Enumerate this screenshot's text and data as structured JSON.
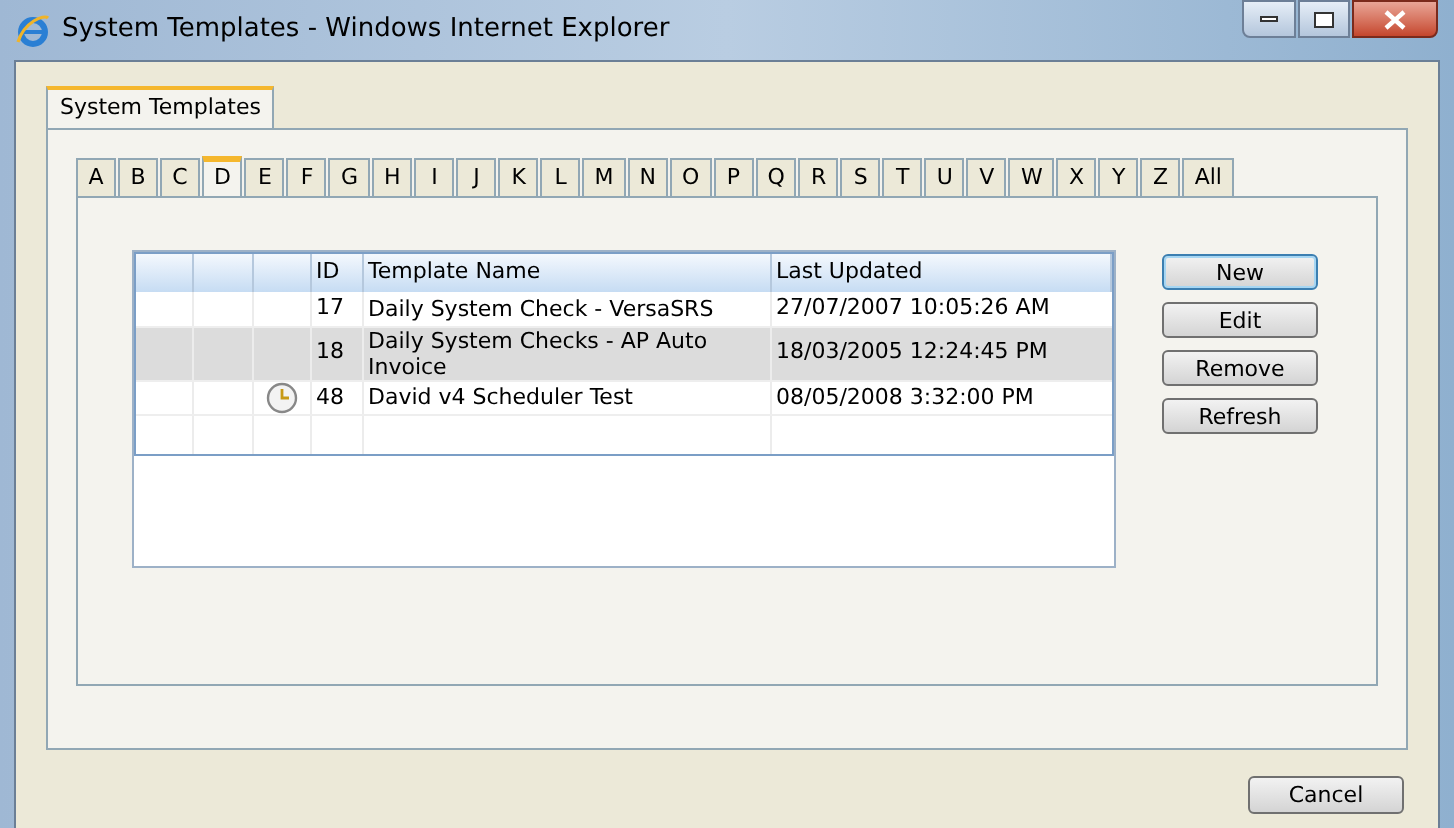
{
  "window": {
    "title": "System Templates - Windows Internet Explorer"
  },
  "tabs": [
    {
      "label": "System Templates",
      "selected": true
    }
  ],
  "letter_tabs": [
    {
      "label": "A",
      "selected": false
    },
    {
      "label": "B",
      "selected": false
    },
    {
      "label": "C",
      "selected": false
    },
    {
      "label": "D",
      "selected": true
    },
    {
      "label": "E",
      "selected": false
    },
    {
      "label": "F",
      "selected": false
    },
    {
      "label": "G",
      "selected": false
    },
    {
      "label": "H",
      "selected": false
    },
    {
      "label": "I",
      "selected": false
    },
    {
      "label": "J",
      "selected": false
    },
    {
      "label": "K",
      "selected": false
    },
    {
      "label": "L",
      "selected": false
    },
    {
      "label": "M",
      "selected": false
    },
    {
      "label": "N",
      "selected": false
    },
    {
      "label": "O",
      "selected": false
    },
    {
      "label": "P",
      "selected": false
    },
    {
      "label": "Q",
      "selected": false
    },
    {
      "label": "R",
      "selected": false
    },
    {
      "label": "S",
      "selected": false
    },
    {
      "label": "T",
      "selected": false
    },
    {
      "label": "U",
      "selected": false
    },
    {
      "label": "V",
      "selected": false
    },
    {
      "label": "W",
      "selected": false
    },
    {
      "label": "X",
      "selected": false
    },
    {
      "label": "Y",
      "selected": false
    },
    {
      "label": "Z",
      "selected": false
    },
    {
      "label": "All",
      "selected": false
    }
  ],
  "table": {
    "columns": [
      "ID",
      "Template Name",
      "Last Updated"
    ],
    "rows": [
      {
        "id": "17",
        "name": "Daily System Check - VersaSRS",
        "updated": "27/07/2007 10:05:26 AM",
        "selected": false,
        "scheduled": false
      },
      {
        "id": "18",
        "name": "Daily System Checks - AP Auto Invoice",
        "updated": "18/03/2005 12:24:45 PM",
        "selected": true,
        "scheduled": false
      },
      {
        "id": "48",
        "name": "David v4 Scheduler Test",
        "updated": "08/05/2008 3:32:00 PM",
        "selected": false,
        "scheduled": true
      }
    ]
  },
  "buttons": [
    {
      "label": "New",
      "focused": true
    },
    {
      "label": "Edit",
      "focused": false
    },
    {
      "label": "Remove",
      "focused": false
    },
    {
      "label": "Refresh",
      "focused": false
    }
  ],
  "footer_button": "Cancel"
}
